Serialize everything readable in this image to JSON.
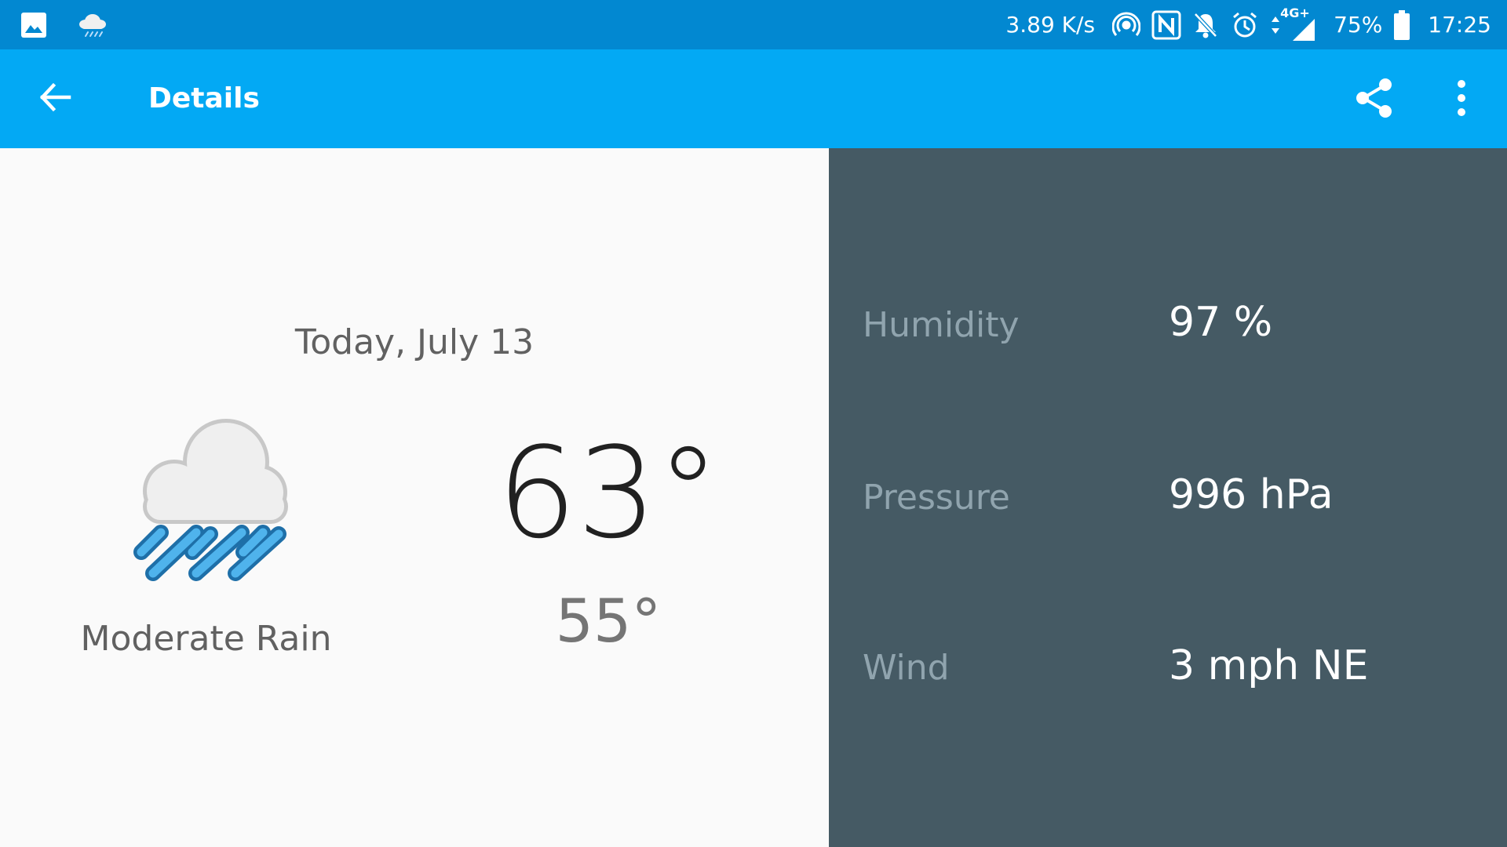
{
  "status_bar": {
    "left_icons": [
      "gallery-icon",
      "rain-cloud-notification-icon"
    ],
    "network_speed": "3.89 K/s",
    "network_type": "4G+",
    "battery": "75%",
    "time": "17:25",
    "icons": [
      "hotspot-icon",
      "nfc-icon",
      "notifications-muted-icon",
      "alarm-icon",
      "data-arrows-icon",
      "signal-icon",
      "battery-icon"
    ]
  },
  "app_bar": {
    "title": "Details",
    "back_icon": "arrow-back-icon",
    "share_icon": "share-icon",
    "menu_icon": "more-vert-icon",
    "color": "#03a9f4"
  },
  "forecast": {
    "date": "Today, July 13",
    "condition": "Moderate Rain",
    "high": "63°",
    "low": "55°",
    "icon": "moderate-rain-icon"
  },
  "details": {
    "humidity_label": "Humidity",
    "humidity_value": "97 %",
    "pressure_label": "Pressure",
    "pressure_value": "996 hPa",
    "wind_label": "Wind",
    "wind_value": "3 mph NE",
    "panel_color": "#455a64"
  }
}
